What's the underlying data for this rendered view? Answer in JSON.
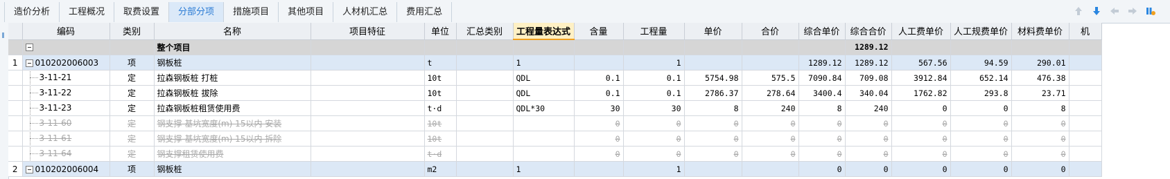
{
  "tabs": [
    {
      "label": "造价分析",
      "active": false
    },
    {
      "label": "工程概况",
      "active": false
    },
    {
      "label": "取费设置",
      "active": false
    },
    {
      "label": "分部分项",
      "active": true
    },
    {
      "label": "措施项目",
      "active": false
    },
    {
      "label": "其他项目",
      "active": false
    },
    {
      "label": "人材机汇总",
      "active": false
    },
    {
      "label": "费用汇总",
      "active": false
    }
  ],
  "toolbar_icons": [
    "arrow-up-icon",
    "arrow-down-icon",
    "arrow-left-icon",
    "arrow-right-icon",
    "column-settings-icon"
  ],
  "columns": [
    "编码",
    "类别",
    "名称",
    "项目特征",
    "单位",
    "汇总类别",
    "工程量表达式",
    "含量",
    "工程量",
    "单价",
    "合价",
    "综合单价",
    "综合合价",
    "人工费单价",
    "人工规费单价",
    "材料费单价",
    "机"
  ],
  "highlighted_column": "工程量表达式",
  "rows": [
    {
      "type": "total",
      "rownum": "",
      "code": "",
      "cat": "",
      "name": "整个项目",
      "feature": "",
      "unit": "",
      "sumcat": "",
      "expr": "",
      "content": "",
      "qty": "",
      "price": "",
      "total": "",
      "comp_price": "",
      "comp_total": "1289.12",
      "labor": "",
      "labor_fee": "",
      "material": ""
    },
    {
      "type": "section",
      "rownum": "1",
      "code": "010202006003",
      "cat": "项",
      "name": "钢板桩",
      "feature": "",
      "unit": "t",
      "sumcat": "",
      "expr": "1",
      "content": "",
      "qty": "1",
      "price": "",
      "total": "",
      "comp_price": "1289.12",
      "comp_total": "1289.12",
      "labor": "567.56",
      "labor_fee": "94.59",
      "material": "290.01"
    },
    {
      "type": "item",
      "rownum": "",
      "code": "3-11-21",
      "cat": "定",
      "name": "拉森钢板桩 打桩",
      "feature": "",
      "unit": "10t",
      "sumcat": "",
      "expr": "QDL",
      "content": "0.1",
      "qty": "0.1",
      "price": "5754.98",
      "total": "575.5",
      "comp_price": "7090.84",
      "comp_total": "709.08",
      "labor": "3912.84",
      "labor_fee": "652.14",
      "material": "476.38"
    },
    {
      "type": "item",
      "rownum": "",
      "code": "3-11-22",
      "cat": "定",
      "name": "拉森钢板桩 拔除",
      "feature": "",
      "unit": "10t",
      "sumcat": "",
      "expr": "QDL",
      "content": "0.1",
      "qty": "0.1",
      "price": "2786.37",
      "total": "278.64",
      "comp_price": "3400.4",
      "comp_total": "340.04",
      "labor": "1762.82",
      "labor_fee": "293.8",
      "material": "23.71"
    },
    {
      "type": "item",
      "rownum": "",
      "code": "3-11-23",
      "cat": "定",
      "name": "拉森钢板桩租赁使用费",
      "feature": "",
      "unit": "t·d",
      "sumcat": "",
      "expr": "QDL*30",
      "content": "30",
      "qty": "30",
      "price": "8",
      "total": "240",
      "comp_price": "8",
      "comp_total": "240",
      "labor": "0",
      "labor_fee": "0",
      "material": "8"
    },
    {
      "type": "disabled",
      "rownum": "",
      "code": "3-11-60",
      "cat": "定",
      "name": "钢支撑 基坑宽度(m) 15以内 安装",
      "feature": "",
      "unit": "10t",
      "sumcat": "",
      "expr": "",
      "content": "0",
      "qty": "0",
      "price": "0",
      "total": "0",
      "comp_price": "0",
      "comp_total": "0",
      "labor": "0",
      "labor_fee": "0",
      "material": "0"
    },
    {
      "type": "disabled",
      "rownum": "",
      "code": "3-11-61",
      "cat": "定",
      "name": "钢支撑 基坑宽度(m) 15以内 拆除",
      "feature": "",
      "unit": "10t",
      "sumcat": "",
      "expr": "",
      "content": "0",
      "qty": "0",
      "price": "0",
      "total": "0",
      "comp_price": "0",
      "comp_total": "0",
      "labor": "0",
      "labor_fee": "0",
      "material": "0"
    },
    {
      "type": "disabled",
      "rownum": "",
      "code": "3-11-64",
      "cat": "定",
      "name": "钢支撑租赁使用费",
      "feature": "",
      "unit": "t·d",
      "sumcat": "",
      "expr": "",
      "content": "0",
      "qty": "0",
      "price": "0",
      "total": "0",
      "comp_price": "0",
      "comp_total": "0",
      "labor": "0",
      "labor_fee": "0",
      "material": "0"
    },
    {
      "type": "section",
      "rownum": "2",
      "code": "010202006004",
      "cat": "项",
      "name": "钢板桩",
      "feature": "",
      "unit": "m2",
      "sumcat": "",
      "expr": "1",
      "content": "",
      "qty": "1",
      "price": "",
      "total": "",
      "comp_price": "0",
      "comp_total": "0",
      "labor": "0",
      "labor_fee": "0",
      "material": "0"
    }
  ]
}
